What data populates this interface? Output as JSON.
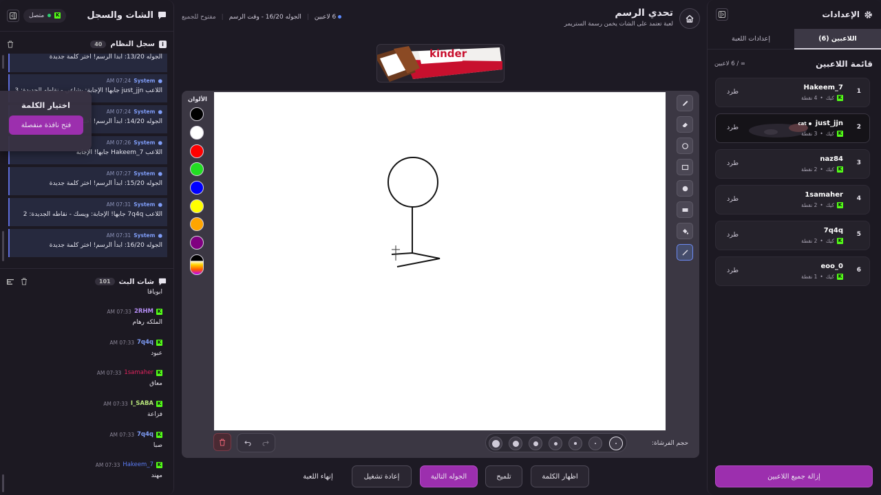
{
  "chat_panel": {
    "title": "الشات والسجل",
    "status": "متصل",
    "system_log": {
      "title": "سجل النظام",
      "count": "40",
      "messages": [
        {
          "time": "",
          "sender": "",
          "text": "الجوله 13/20: ابدأ الرسم! اختر كلمة جديدة"
        },
        {
          "time": "07:24 AM",
          "sender": "System",
          "text": "اللاعب just_jjn جابها! الإجابة: بشاعي - نقاطه الجديدة: 3"
        },
        {
          "time": "07:24 AM",
          "sender": "System",
          "text": "الجوله 14/20: ابدأ الرسم! اختر كلمة جديدة"
        },
        {
          "time": "07:26 AM",
          "sender": "System",
          "text": "اللاعب Hakeem_7 جابها! الإجابة"
        },
        {
          "time": "07:27 AM",
          "sender": "System",
          "text": "الجوله 15/20: ابدأ الرسم! اختر كلمة جديدة"
        },
        {
          "time": "07:31 AM",
          "sender": "System",
          "text": "اللاعب 7q4q جابها! الإجابة: ويسك - نقاطه الجديدة: 2"
        },
        {
          "time": "07:31 AM",
          "sender": "System",
          "text": "الجوله 16/20: ابدأ الرسم! اختر كلمة جديدة"
        }
      ]
    },
    "word_popup": {
      "title": "اختيار الكلمة",
      "button": "فتح نافذة منفصلة"
    },
    "stream_chat": {
      "title": "شات البث",
      "count": "101",
      "messages": [
        {
          "time": "",
          "user": "",
          "color": "",
          "text": "ابوياقا"
        },
        {
          "time": "07:33 AM",
          "user": "2RHM",
          "color": "#b58df5",
          "text": "الملكه رهام"
        },
        {
          "time": "07:33 AM",
          "user": "7q4q",
          "color": "#7f9df8",
          "text": "عبود"
        },
        {
          "time": "07:33 AM",
          "user": "1samaher",
          "color": "#e0245e",
          "text": "معاق"
        },
        {
          "time": "07:33 AM",
          "user": "I_SABA",
          "color": "#b6e37a",
          "text": "فزاعة"
        },
        {
          "time": "07:33 AM",
          "user": "7q4q",
          "color": "#7f9df8",
          "text": "صبا"
        },
        {
          "time": "07:33 AM",
          "user": "Hakeem_7",
          "color": "#5b7cf5",
          "text": "مهند"
        }
      ]
    }
  },
  "game": {
    "title": "تحدي الرسم",
    "subtitle": "لعبة تعتمد على الشات يخمن رسمة الستريمر",
    "players_info": "6 لاعبين",
    "round_info": "الجوله 16/20 - وقت الرسم",
    "open_info": "مفتوح للجميع",
    "banner_text": "kinder",
    "colors_label": "الألوان",
    "colors": [
      "#000000",
      "#ffffff",
      "#ff0000",
      "#22dd22",
      "#0000ff",
      "#ffff00",
      "#ffa500",
      "#800080"
    ],
    "tools": [
      "pencil-icon",
      "eraser-icon",
      "circle-icon",
      "rectangle-icon",
      "filled-circle-icon",
      "filled-rectangle-icon",
      "fill-bucket-icon",
      "line-icon"
    ],
    "brush_label": "حجم الفرشاة:",
    "brush_sizes_count": 7,
    "actions": {
      "reveal_word": "اظهار الكلمة",
      "hint": "تلميح",
      "next_round": "الجوله التالية",
      "restart": "إعادة تشغيل",
      "end_game": "إنهاء اللعبة"
    }
  },
  "settings": {
    "title": "الإعدادات",
    "tab_players": "اللاعبين (6)",
    "tab_game": "إعدادات اللعبة",
    "list_title": "قائمة اللاعبين",
    "list_count": "∞ / 6 لاعبين",
    "kick_label": "طرد",
    "platform": "كيك",
    "players": [
      {
        "rank": "1",
        "name": "Hakeem_7",
        "points": "4 نقطة",
        "tag": ""
      },
      {
        "rank": "2",
        "name": "just_jjn",
        "points": "3 نقطة",
        "tag": "cat"
      },
      {
        "rank": "3",
        "name": "naz84",
        "points": "2 نقطة",
        "tag": ""
      },
      {
        "rank": "4",
        "name": "1samaher",
        "points": "2 نقطة",
        "tag": ""
      },
      {
        "rank": "5",
        "name": "7q4q",
        "points": "2 نقطة",
        "tag": ""
      },
      {
        "rank": "6",
        "name": "eoo_0",
        "points": "1 نقطة",
        "tag": ""
      }
    ],
    "remove_all": "إزالة جميع اللاعبين"
  }
}
